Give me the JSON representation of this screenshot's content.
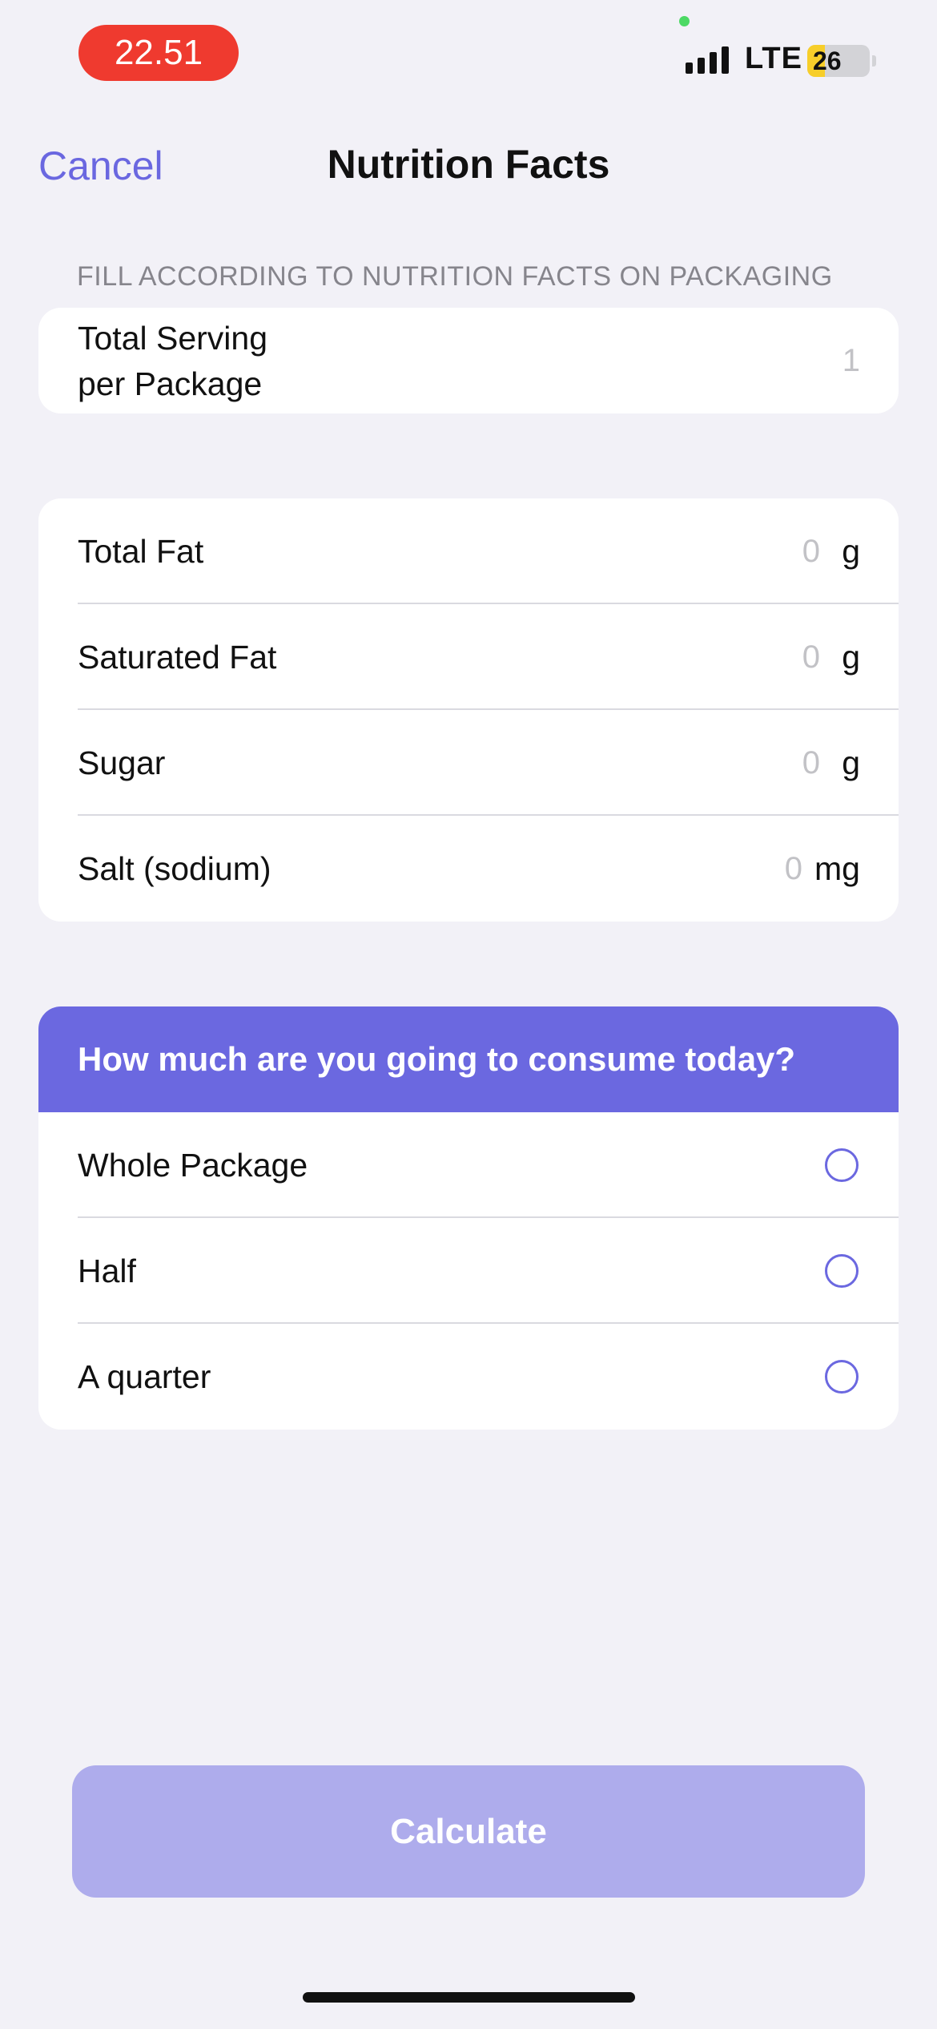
{
  "status_bar": {
    "time": "22.51",
    "network": "LTE",
    "battery": "26"
  },
  "nav": {
    "cancel_label": "Cancel",
    "title": "Nutrition Facts"
  },
  "section_header": "FILL ACCORDING TO NUTRITION FACTS ON PACKAGING",
  "serving": {
    "label_line1": "Total Serving",
    "label_line2": "per Package",
    "value": "1"
  },
  "nutrients": [
    {
      "label": "Total Fat",
      "value": "0",
      "unit": "g"
    },
    {
      "label": "Saturated Fat",
      "value": "0",
      "unit": "g"
    },
    {
      "label": "Sugar",
      "value": "0",
      "unit": "g"
    },
    {
      "label": "Salt (sodium)",
      "value": "0",
      "unit": "mg"
    }
  ],
  "consumption": {
    "question": "How much are you going to consume today?",
    "options": [
      {
        "label": "Whole Package"
      },
      {
        "label": "Half"
      },
      {
        "label": "A quarter"
      }
    ]
  },
  "calculate_label": "Calculate",
  "colors": {
    "accent": "#6B68E0",
    "button_disabled": "#AEACEC",
    "background": "#F2F1F7",
    "time_pill": "#EF3A2F"
  }
}
